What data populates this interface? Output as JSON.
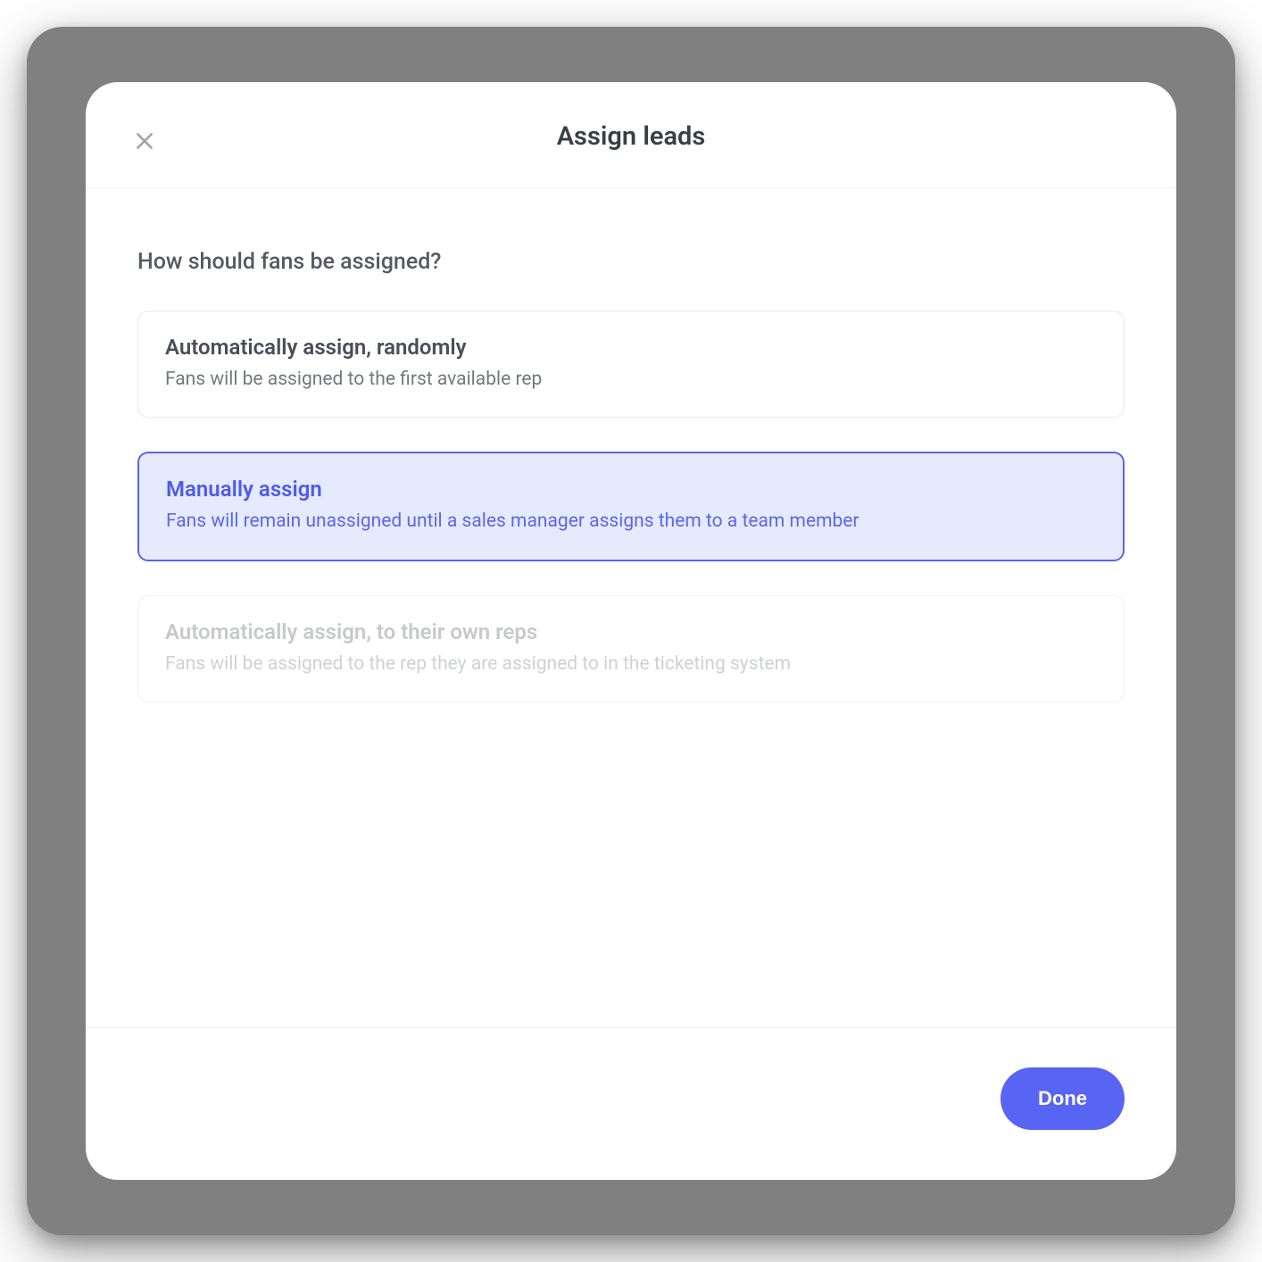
{
  "dialog": {
    "title": "Assign leads",
    "question": "How should fans be assigned?",
    "options": [
      {
        "title": "Automatically assign, randomly",
        "desc": "Fans will be assigned to the first available rep",
        "state": "default"
      },
      {
        "title": "Manually assign",
        "desc": "Fans will remain unassigned until a sales manager assigns them to a team member",
        "state": "selected"
      },
      {
        "title": "Automatically assign, to their own reps",
        "desc": "Fans will be assigned to the rep they are assigned to in the ticketing system",
        "state": "disabled"
      }
    ],
    "done_label": "Done"
  }
}
